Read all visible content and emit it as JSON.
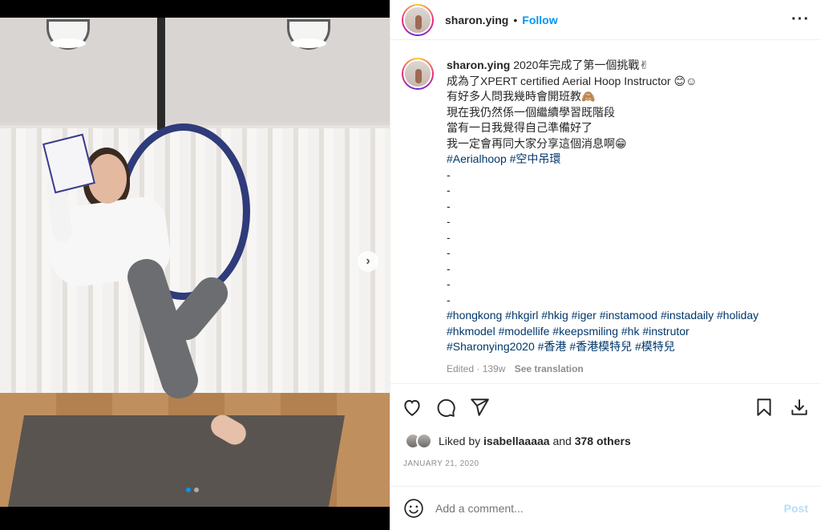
{
  "post": {
    "username": "sharon.ying",
    "follow_label": "Follow",
    "separator": "•",
    "more_label": "···"
  },
  "caption": {
    "username": "sharon.ying",
    "lines": [
      "2020年完成了第一個挑戰✌",
      "成為了XPERT certified Aerial Hoop Instructor 😊☺",
      "有好多人問我幾時會開班教🙈",
      "現在我仍然係一個繼續學習既階段",
      "當有一日我覺得自己準備好了",
      "我一定會再同大家分享這個消息啊😁"
    ],
    "hashtags_1": "#Aerialhoop #空中吊環",
    "dashes": [
      "-",
      "-",
      "-",
      "-",
      "-",
      "-",
      "-",
      "-",
      "-"
    ],
    "hashtags_2": "#hongkong #hkgirl #hkig #iger #instamood #instadaily #holiday",
    "hashtags_3": "#hkmodel #modellife #keepsmiling #hk #instrutor",
    "hashtags_4": "#Sharonying2020 #香港 #香港模特兒 #模特兒",
    "edited": "Edited · 139w",
    "see_translation": "See translation"
  },
  "actions": {
    "icons": [
      "heart-icon",
      "comment-icon",
      "share-icon",
      "bookmark-icon",
      "download-icon"
    ]
  },
  "likes": {
    "prefix": "Liked by",
    "user": "isabellaaaaa",
    "and": "and",
    "others": "378 others"
  },
  "date": "JANUARY 21, 2020",
  "comment": {
    "placeholder": "Add a comment...",
    "post_label": "Post"
  },
  "carousel": {
    "next_label": "›",
    "dot_count": 2,
    "active_dot": 0
  },
  "colors": {
    "link": "#0095f6",
    "tag": "#00376b",
    "muted": "#8e8e8e",
    "post_disabled": "#b2dffc"
  }
}
